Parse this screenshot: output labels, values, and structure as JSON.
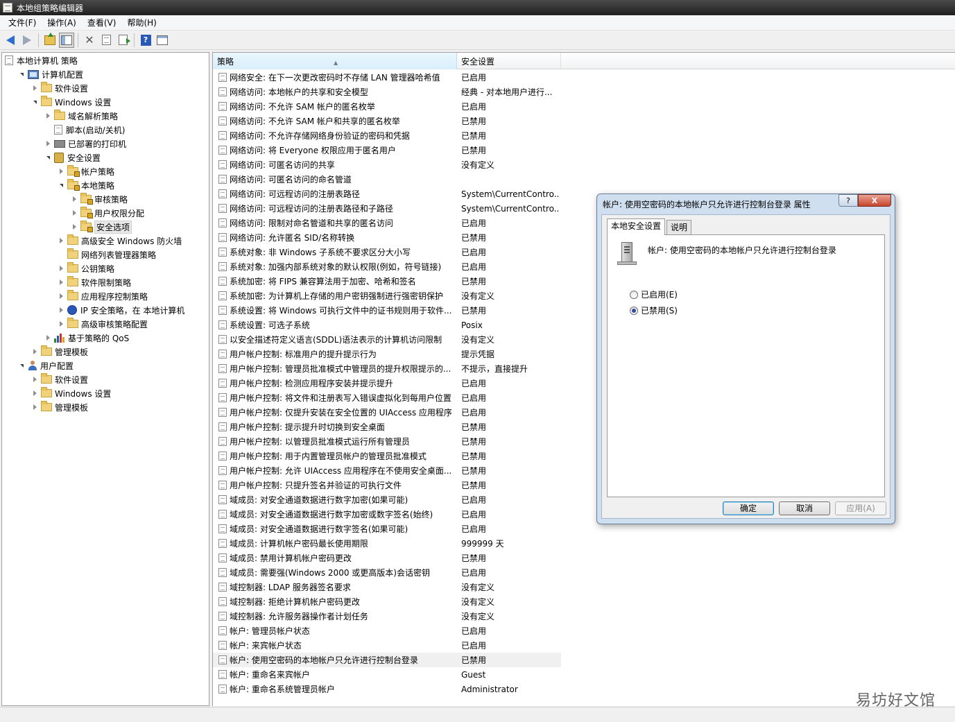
{
  "window": {
    "title": "本地组策略编辑器"
  },
  "menu": [
    "文件(F)",
    "操作(A)",
    "查看(V)",
    "帮助(H)"
  ],
  "tree": [
    {
      "label": "本地计算机 策略",
      "level": 0,
      "icon": "doc",
      "exp": "none"
    },
    {
      "label": "计算机配置",
      "level": 1,
      "icon": "pc",
      "exp": "open"
    },
    {
      "label": "软件设置",
      "level": 2,
      "icon": "folder",
      "exp": "closed"
    },
    {
      "label": "Windows 设置",
      "level": 2,
      "icon": "folder",
      "exp": "open"
    },
    {
      "label": "域名解析策略",
      "level": 3,
      "icon": "folder",
      "exp": "closed"
    },
    {
      "label": "脚本(启动/关机)",
      "level": 3,
      "icon": "doc",
      "exp": "none"
    },
    {
      "label": "已部署的打印机",
      "level": 3,
      "icon": "printer",
      "exp": "closed"
    },
    {
      "label": "安全设置",
      "level": 3,
      "icon": "shield",
      "exp": "open"
    },
    {
      "label": "帐户策略",
      "level": 4,
      "icon": "folder-lock",
      "exp": "closed"
    },
    {
      "label": "本地策略",
      "level": 4,
      "icon": "folder-lock",
      "exp": "open"
    },
    {
      "label": "审核策略",
      "level": 5,
      "icon": "folder-lock",
      "exp": "closed"
    },
    {
      "label": "用户权限分配",
      "level": 5,
      "icon": "folder-lock",
      "exp": "closed"
    },
    {
      "label": "安全选项",
      "level": 5,
      "icon": "folder-lock",
      "exp": "closed",
      "selected": true
    },
    {
      "label": "高级安全 Windows 防火墙",
      "level": 4,
      "icon": "folder",
      "exp": "closed"
    },
    {
      "label": "网络列表管理器策略",
      "level": 4,
      "icon": "folder",
      "exp": "none"
    },
    {
      "label": "公钥策略",
      "level": 4,
      "icon": "folder",
      "exp": "closed"
    },
    {
      "label": "软件限制策略",
      "level": 4,
      "icon": "folder",
      "exp": "closed"
    },
    {
      "label": "应用程序控制策略",
      "level": 4,
      "icon": "folder",
      "exp": "closed"
    },
    {
      "label": "IP 安全策略，在 本地计算机",
      "level": 4,
      "icon": "ipsec",
      "exp": "closed"
    },
    {
      "label": "高级审核策略配置",
      "level": 4,
      "icon": "folder",
      "exp": "closed"
    },
    {
      "label": "基于策略的 QoS",
      "level": 3,
      "icon": "qos",
      "exp": "closed"
    },
    {
      "label": "管理模板",
      "level": 2,
      "icon": "folder",
      "exp": "closed"
    },
    {
      "label": "用户配置",
      "level": 1,
      "icon": "user",
      "exp": "open"
    },
    {
      "label": "软件设置",
      "level": 2,
      "icon": "folder",
      "exp": "closed"
    },
    {
      "label": "Windows 设置",
      "level": 2,
      "icon": "folder",
      "exp": "closed"
    },
    {
      "label": "管理模板",
      "level": 2,
      "icon": "folder",
      "exp": "closed"
    }
  ],
  "list": {
    "headers": {
      "policy": "策略",
      "setting": "安全设置"
    },
    "rows": [
      [
        "网络安全: 在下一次更改密码时不存储 LAN 管理器哈希值",
        "已启用"
      ],
      [
        "网络访问: 本地帐户的共享和安全模型",
        "经典 - 对本地用户进行..."
      ],
      [
        "网络访问: 不允许 SAM 帐户的匿名枚举",
        "已启用"
      ],
      [
        "网络访问: 不允许 SAM 帐户和共享的匿名枚举",
        "已禁用"
      ],
      [
        "网络访问: 不允许存储网络身份验证的密码和凭据",
        "已禁用"
      ],
      [
        "网络访问: 将 Everyone 权限应用于匿名用户",
        "已禁用"
      ],
      [
        "网络访问: 可匿名访问的共享",
        "没有定义"
      ],
      [
        "网络访问: 可匿名访问的命名管道",
        ""
      ],
      [
        "网络访问: 可远程访问的注册表路径",
        "System\\CurrentContro..."
      ],
      [
        "网络访问: 可远程访问的注册表路径和子路径",
        "System\\CurrentContro..."
      ],
      [
        "网络访问: 限制对命名管道和共享的匿名访问",
        "已启用"
      ],
      [
        "网络访问: 允许匿名 SID/名称转换",
        "已禁用"
      ],
      [
        "系统对象: 非 Windows 子系统不要求区分大小写",
        "已启用"
      ],
      [
        "系统对象: 加强内部系统对象的默认权限(例如，符号链接)",
        "已启用"
      ],
      [
        "系统加密: 将 FIPS 兼容算法用于加密、哈希和签名",
        "已禁用"
      ],
      [
        "系统加密: 为计算机上存储的用户密钥强制进行强密钥保护",
        "没有定义"
      ],
      [
        "系统设置: 将 Windows 可执行文件中的证书规则用于软件...",
        "已禁用"
      ],
      [
        "系统设置: 可选子系统",
        "Posix"
      ],
      [
        "以安全描述符定义语言(SDDL)语法表示的计算机访问限制",
        "没有定义"
      ],
      [
        "用户帐户控制: 标准用户的提升提示行为",
        "提示凭据"
      ],
      [
        "用户帐户控制: 管理员批准模式中管理员的提升权限提示的...",
        "不提示，直接提升"
      ],
      [
        "用户帐户控制: 检测应用程序安装并提示提升",
        "已启用"
      ],
      [
        "用户帐户控制: 将文件和注册表写入错误虚拟化到每用户位置",
        "已启用"
      ],
      [
        "用户帐户控制: 仅提升安装在安全位置的 UIAccess 应用程序",
        "已启用"
      ],
      [
        "用户帐户控制: 提示提升时切换到安全桌面",
        "已禁用"
      ],
      [
        "用户帐户控制: 以管理员批准模式运行所有管理员",
        "已禁用"
      ],
      [
        "用户帐户控制: 用于内置管理员帐户的管理员批准模式",
        "已禁用"
      ],
      [
        "用户帐户控制: 允许 UIAccess 应用程序在不使用安全桌面...",
        "已禁用"
      ],
      [
        "用户帐户控制: 只提升签名并验证的可执行文件",
        "已禁用"
      ],
      [
        "域成员: 对安全通道数据进行数字加密(如果可能)",
        "已启用"
      ],
      [
        "域成员: 对安全通道数据进行数字加密或数字签名(始终)",
        "已启用"
      ],
      [
        "域成员: 对安全通道数据进行数字签名(如果可能)",
        "已启用"
      ],
      [
        "域成员: 计算机帐户密码最长使用期限",
        "999999 天"
      ],
      [
        "域成员: 禁用计算机帐户密码更改",
        "已禁用"
      ],
      [
        "域成员: 需要强(Windows 2000 或更高版本)会话密钥",
        "已启用"
      ],
      [
        "域控制器: LDAP 服务器签名要求",
        "没有定义"
      ],
      [
        "域控制器: 拒绝计算机帐户密码更改",
        "没有定义"
      ],
      [
        "域控制器: 允许服务器操作者计划任务",
        "没有定义"
      ],
      [
        "帐户: 管理员帐户状态",
        "已启用"
      ],
      [
        "帐户: 来宾帐户状态",
        "已启用"
      ],
      [
        "帐户: 使用空密码的本地帐户只允许进行控制台登录",
        "已禁用"
      ],
      [
        "帐户: 重命名来宾帐户",
        "Guest"
      ],
      [
        "帐户: 重命名系统管理员帐户",
        "Administrator"
      ]
    ],
    "selected_index": 40
  },
  "dialog": {
    "title": "帐户: 使用空密码的本地帐户只允许进行控制台登录 属性",
    "help_glyph": "?",
    "close_glyph": "X",
    "tabs": [
      "本地安全设置",
      "说明"
    ],
    "heading": "帐户: 使用空密码的本地帐户只允许进行控制台登录",
    "options": [
      "已启用(E)",
      "已禁用(S)"
    ],
    "selected_option": 1,
    "buttons": {
      "ok": "确定",
      "cancel": "取消",
      "apply": "应用(A)"
    }
  },
  "watermark": "易坊好文馆"
}
